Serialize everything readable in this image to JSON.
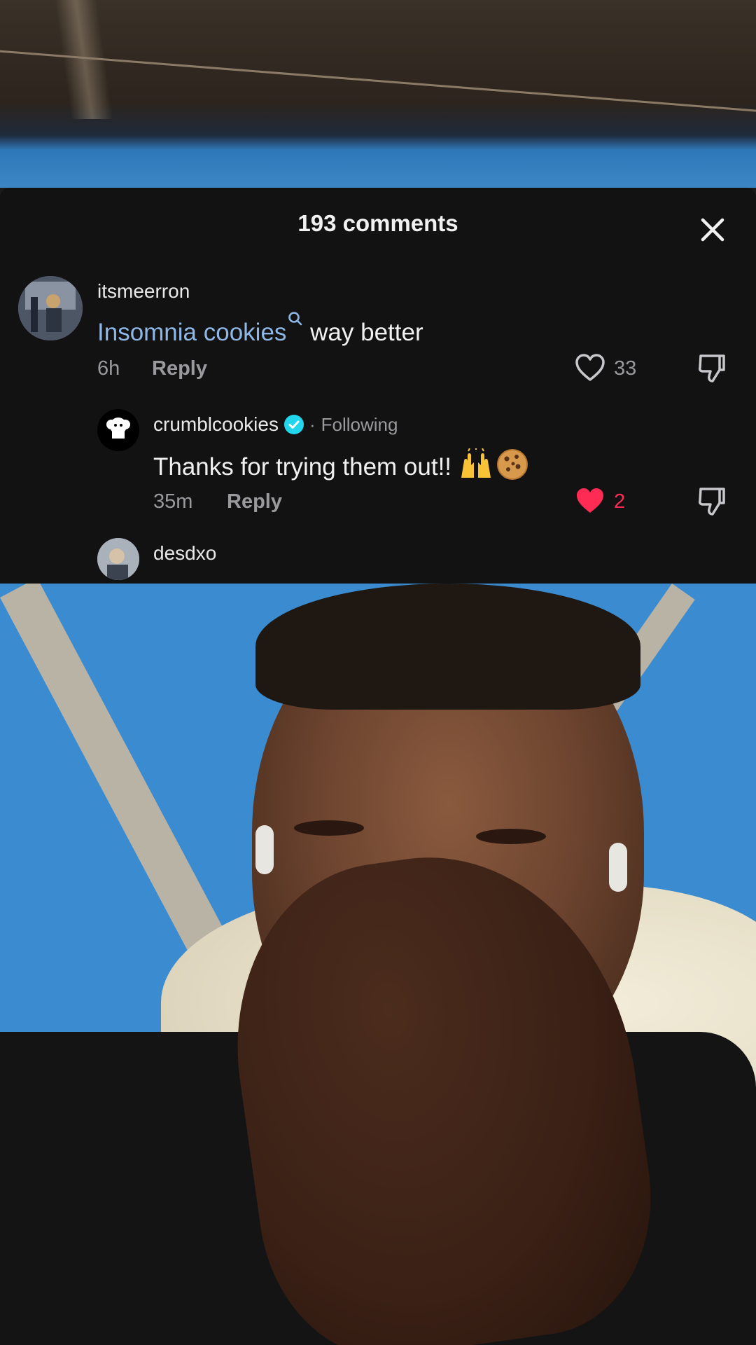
{
  "comments_sheet": {
    "title": "193 comments",
    "comments": [
      {
        "username": "itsmeerron",
        "link_text": "Insomnia cookies",
        "text_after_link": " way better",
        "time": "6h",
        "reply_label": "Reply",
        "like_count": "33",
        "liked": false
      },
      {
        "username": "crumblcookies",
        "verified": true,
        "relation": "Following",
        "text": "Thanks for trying them out!!",
        "time": "35m",
        "reply_label": "Reply",
        "like_count": "2",
        "liked": true
      },
      {
        "username": "desdxo"
      }
    ]
  },
  "colors": {
    "sheet_background": "#121212",
    "liked": "#fe2c55",
    "search_link": "#8fb7e6",
    "verified_badge": "#20d5ec"
  }
}
